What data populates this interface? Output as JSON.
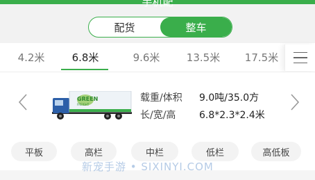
{
  "header": {
    "title": "手机配"
  },
  "segment": {
    "left": "配货",
    "right": "整车"
  },
  "tabs": [
    "4.2米",
    "6.8米",
    "9.6米",
    "13.5米",
    "17.5米"
  ],
  "active_tab": 1,
  "truck": {
    "brand_text": "GREEN",
    "sub_text": "FREIGHT"
  },
  "specs": {
    "load_label": "载重/体积",
    "load_value": "9.0吨/35.0方",
    "size_label": "长/宽/高",
    "size_value": "6.8*2.3*2.4米"
  },
  "chips": [
    "平板",
    "高栏",
    "中栏",
    "低栏",
    "高低板"
  ],
  "watermark": "新宠手游 • SIXINYI.COM",
  "colors": {
    "accent": "#3aae4b"
  }
}
